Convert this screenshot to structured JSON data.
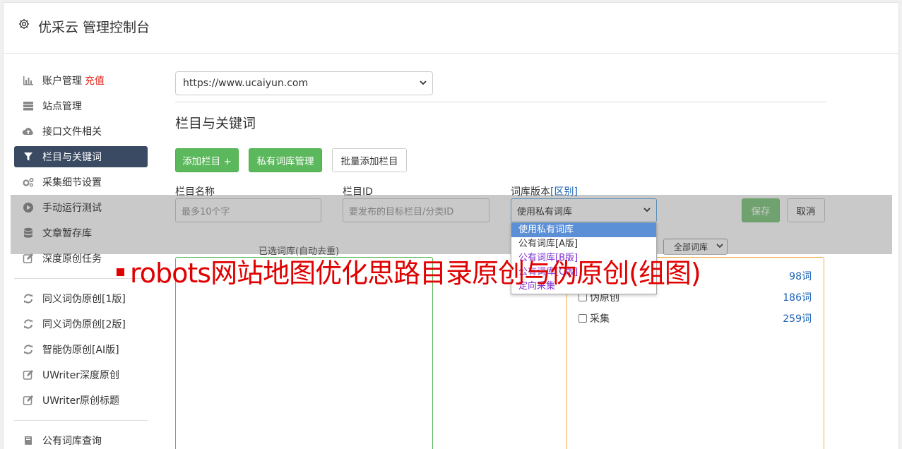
{
  "app": {
    "title": "优采云 管理控制台"
  },
  "sidebar": {
    "items": [
      {
        "label": "账户管理",
        "badge": "充值",
        "icon": "bar-chart-icon"
      },
      {
        "label": "站点管理",
        "icon": "server-icon"
      },
      {
        "label": "接口文件相关",
        "icon": "cloud-upload-icon"
      },
      {
        "label": "栏目与关键词",
        "icon": "filter-icon",
        "active": true
      },
      {
        "label": "采集细节设置",
        "icon": "gears-icon"
      },
      {
        "label": "手动运行测试",
        "icon": "play-icon"
      },
      {
        "label": "文章暂存库",
        "icon": "database-icon"
      },
      {
        "label": "深度原创任务",
        "icon": "edit-icon"
      },
      {
        "label": "同义词伪原创[1版]",
        "icon": "refresh-icon"
      },
      {
        "label": "同义词伪原创[2版]",
        "icon": "refresh-icon"
      },
      {
        "label": "智能伪原创[AI版]",
        "icon": "refresh-icon"
      },
      {
        "label": "UWriter深度原创",
        "icon": "edit-icon"
      },
      {
        "label": "UWriter原创标题",
        "icon": "edit-icon"
      },
      {
        "label": "公有词库查询",
        "icon": "book-icon"
      }
    ]
  },
  "main": {
    "site_select_value": "https://www.ucaiyun.com",
    "section_title": "栏目与关键词",
    "buttons": {
      "add_column": "添加栏目 +",
      "private_lib": "私有词库管理",
      "batch_add": "批量添加栏目"
    },
    "form": {
      "column_name_label": "栏目名称",
      "column_name_placeholder": "最多10个字",
      "column_id_label": "栏目ID",
      "column_id_placeholder": "要发布的目标栏目/分类ID",
      "lib_version_label": "词库版本",
      "lib_version_link": "[区别]",
      "lib_version_value": "使用私有词库",
      "save": "保存",
      "cancel": "取消"
    },
    "dropdown_options": [
      "使用私有词库",
      "公有词库[A版]",
      "公有词库[B版]",
      "公有词库[C版]",
      "定向采集"
    ],
    "selected_lib_title": "已选词库(自动去重)",
    "all_lib_select": "全部词库",
    "libraries": [
      {
        "name": "伪原创",
        "count": "186词"
      },
      {
        "name": "采集",
        "count": "259词"
      }
    ],
    "partial_count": "98词"
  },
  "banner": {
    "text": "robots网站地图优化思路目录原创与伪原创(组图)"
  }
}
